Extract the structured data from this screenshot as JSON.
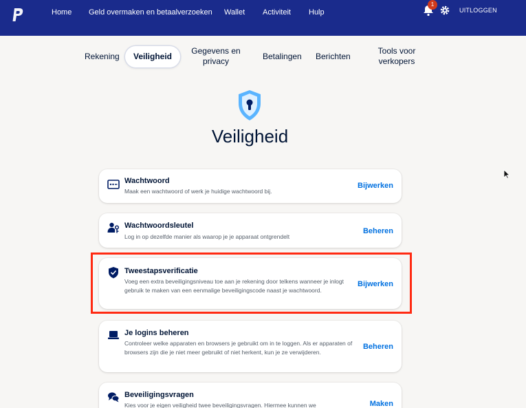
{
  "topbar": {
    "nav": [
      "Home",
      "Geld overmaken en betaalverzoeken",
      "Wallet",
      "Activiteit",
      "Hulp"
    ],
    "notification_count": "1",
    "logout_label": "UITLOGGEN",
    "colors": {
      "bar": "#1a2b8c",
      "badge": "#d03a1c"
    }
  },
  "tabs": [
    {
      "label": "Rekening"
    },
    {
      "label": "Veiligheid",
      "active": true
    },
    {
      "label": "Gegevens en privacy"
    },
    {
      "label": "Betalingen"
    },
    {
      "label": "Berichten"
    },
    {
      "label": "Tools voor verkopers"
    }
  ],
  "page": {
    "title": "Veiligheid",
    "hero_icon": "keyhole-shield-icon"
  },
  "cards": [
    {
      "icon": "password-dots-icon",
      "title": "Wachtwoord",
      "desc": "Maak een wachtwoord of werk je huidige wachtwoord bij.",
      "action": "Bijwerken"
    },
    {
      "icon": "user-key-icon",
      "title": "Wachtwoordsleutel",
      "desc": "Log in op dezelfde manier als waarop je je apparaat ontgrendelt",
      "action": "Beheren"
    },
    {
      "icon": "shield-check-icon",
      "title": "Tweestapsverificatie",
      "desc": "Voeg een extra beveiligingsniveau toe aan je rekening door telkens wanneer je inlogt gebruik te maken van een eenmalige beveiligingscode naast je wachtwoord.",
      "action": "Bijwerken"
    },
    {
      "icon": "laptop-icon",
      "title": "Je logins beheren",
      "desc": "Controleer welke apparaten en browsers je gebruikt om in te loggen. Als er apparaten of browsers zijn die je niet meer gebruikt of niet herkent, kun je ze verwijderen.",
      "action": "Beheren"
    },
    {
      "icon": "chat-bubbles-icon",
      "title": "Beveiligingsvragen",
      "desc": "Kies voor je eigen veiligheid twee beveiligingsvragen. Hiermee kunnen we",
      "action": "Maken"
    }
  ],
  "colors": {
    "accent": "#0070e0",
    "highlight": "#ff2a12",
    "hero_shield": "#5ab4ff"
  }
}
